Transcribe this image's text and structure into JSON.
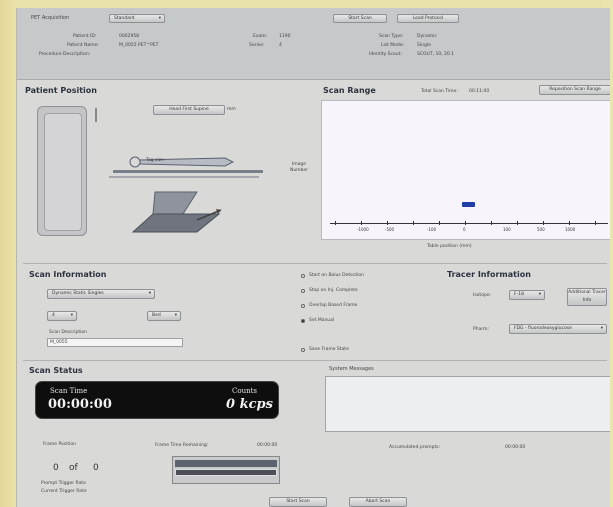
{
  "header": {
    "acq_label": "PET Acquisition",
    "acq_dropdown": "Standard",
    "new_scan_btn": "Start Scan",
    "load_protocol_btn": "Load Protocol",
    "patient_id_label": "Patient ID:",
    "patient_id": "0002958",
    "patient_name_label": "Patient Name:",
    "patient_name": "M_0055 PET^PET",
    "exam_desc_label": "Procedure Description:",
    "exam_desc": "",
    "exam_label": "Exam:",
    "exam": "1190",
    "series_label": "Series:",
    "series": "4",
    "scan_type_label": "Scan Type:",
    "scan_type": "Dynamic",
    "list_mode_label": "List Mode:",
    "list_mode": "Single",
    "identity_label": "Identity Scout:",
    "identity": "SCOUT, 10, 20.1"
  },
  "patient_position": {
    "title": "Patient Position",
    "orientation_btn": "Head First Supine",
    "tag_label": "Tag size",
    "scanner_label": "Image Number"
  },
  "scan_range": {
    "title": "Scan Range",
    "total_label": "Total Scan Time:",
    "total_value": "00:11:00",
    "button": "Reposition Scan Range",
    "ticks": [
      "-1000",
      "-500",
      "-100",
      "0",
      "100",
      "500",
      "1000"
    ],
    "axis_label": "Table position (mm)"
  },
  "scan_info": {
    "title": "Scan Information",
    "type_dropdown": "Dynamic Static Singles",
    "num_dropdown": "4",
    "unit_dropdown": "Bed",
    "desc_label": "Scan Description",
    "desc_value": "M_0055",
    "options": [
      {
        "label": "Start on Bolus Detection",
        "checked": false
      },
      {
        "label": "Stop on Inj. Complete",
        "checked": false
      },
      {
        "label": "Overlap Based Frame",
        "checked": false
      },
      {
        "label": "Set Manual",
        "checked": true
      },
      {
        "label": "Save Frame State",
        "checked": false
      }
    ]
  },
  "tracer": {
    "title": "Tracer Information",
    "isotope_label": "Isotope:",
    "isotope": "F-18",
    "button": "Additional Tracer Info",
    "pharm_label": "Pharm:",
    "pharm": "FDG - fluorodeoxyglucose"
  },
  "scan_status": {
    "title": "Scan Status",
    "scan_time_label": "Scan Time",
    "scan_time": "00:00:00",
    "counts_label": "Counts",
    "counts": "0 kcps",
    "frame_position_label": "Frame Position",
    "frame_time_label": "Frame Time Remaining:",
    "frame_time": "00:00:00",
    "frame_current": "0",
    "of_label": "of",
    "frame_total": "0",
    "prompt_label": "Prompt Trigger Rate",
    "current_label": "Current Trigger Rate"
  },
  "messages": {
    "title": "System Messages",
    "accum_label": "Accumulated prompts:",
    "accum_value": "00:00:00"
  },
  "footer": {
    "start_btn": "Start Scan",
    "abort_btn": "Abort Scan"
  },
  "colors": {
    "screen_bg": "#d9d9d7",
    "status_panel": "#0e0e0e",
    "scan_range_plot": "#f7f5fb",
    "marker": "#1f3ea6",
    "bezel": "#e8e0a8"
  }
}
